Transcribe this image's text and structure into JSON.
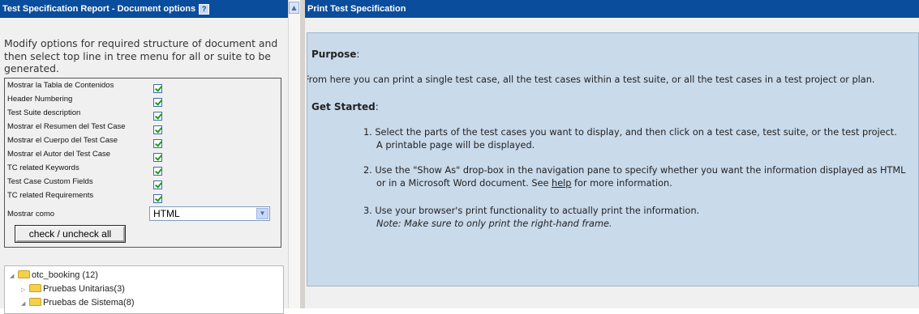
{
  "left_panel": {
    "title": "Test Specification Report - Document options",
    "help_icon": "?",
    "intro_text": "Modify options for required structure of document and then select top line in tree menu for all or suite to be generated.",
    "options": [
      {
        "label": "Mostrar la Tabla de Contenidos",
        "checked": true
      },
      {
        "label": "Header Numbering",
        "checked": true
      },
      {
        "label": "Test Suite description",
        "checked": true
      },
      {
        "label": "Mostrar el Resumen del Test Case",
        "checked": true
      },
      {
        "label": "Mostrar el Cuerpo del Test Case",
        "checked": true
      },
      {
        "label": "Mostrar el Autor del Test Case",
        "checked": true
      },
      {
        "label": "TC related Keywords",
        "checked": true
      },
      {
        "label": "Test Case Custom Fields",
        "checked": true
      },
      {
        "label": "TC related Requirements",
        "checked": true
      }
    ],
    "format_label": "Mostrar como",
    "format_value": "HTML",
    "check_button": "check / uncheck all",
    "tree": [
      {
        "label": "otc_booking (12)",
        "expanded": true
      },
      {
        "label": "Pruebas Unitarias(3)",
        "expanded": false
      },
      {
        "label": "Pruebas de Sistema(8)",
        "expanded": true
      }
    ]
  },
  "right_panel": {
    "title": "Print Test Specification",
    "purpose_heading": "Purpose",
    "colon": ":",
    "purpose_text": "From here you can print a single test case, all the test cases within a test suite, or all the test cases in a test project or plan.",
    "get_started_heading": "Get Started",
    "steps": [
      {
        "num": "1.",
        "line1": "Select the parts of the test cases you want to display, and then click on a test case, test suite, or the test project.",
        "line2": "A printable page will be displayed."
      },
      {
        "num": "2.",
        "line1": "Use the \"Show As\" drop-box in the navigation pane to specify whether you want the information displayed as HTML",
        "line2_pre": "or in a Microsoft Word document. See ",
        "line2_link": "help",
        "line2_post": " for more information."
      },
      {
        "num": "3.",
        "line1": "Use your browser's print functionality to actually print the information.",
        "line2": "Note: Make sure to only print the right-hand frame."
      }
    ]
  },
  "colors": {
    "title_bar": "#0a4d9c",
    "content_bg": "#c9daeb",
    "check": "#1f9a1f"
  }
}
